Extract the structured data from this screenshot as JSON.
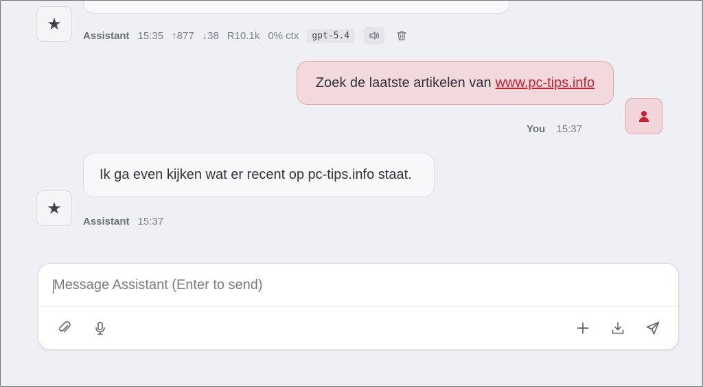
{
  "messages": {
    "first_meta": {
      "author": "Assistant",
      "time": "15:35",
      "tokens_up": "↑877",
      "tokens_down": "↓38",
      "ratio": "R10.1k",
      "ctx": "0% ctx",
      "model": "gpt-5.4"
    },
    "user_message": {
      "text": "Zoek de laatste artikelen van",
      "link": "www.pc-tips.info",
      "author": "You",
      "time": "15:37"
    },
    "bot_message": {
      "text": "Ik ga even kijken wat er recent op pc-tips.info staat.",
      "author": "Assistant",
      "time": "15:37"
    }
  },
  "composer": {
    "placeholder": "Message Assistant (Enter to send)"
  },
  "icons": {
    "assistant_avatar": "star-icon",
    "user_avatar": "person-icon",
    "speaker": "speaker-icon",
    "trash": "trash-icon",
    "attach": "paperclip-icon",
    "mic": "microphone-icon",
    "plus": "plus-icon",
    "download": "download-icon",
    "send": "send-icon"
  },
  "colors": {
    "background": "#eef0f4",
    "user_accent": "#d11f2a",
    "user_bubble": "#f1d9dd"
  }
}
